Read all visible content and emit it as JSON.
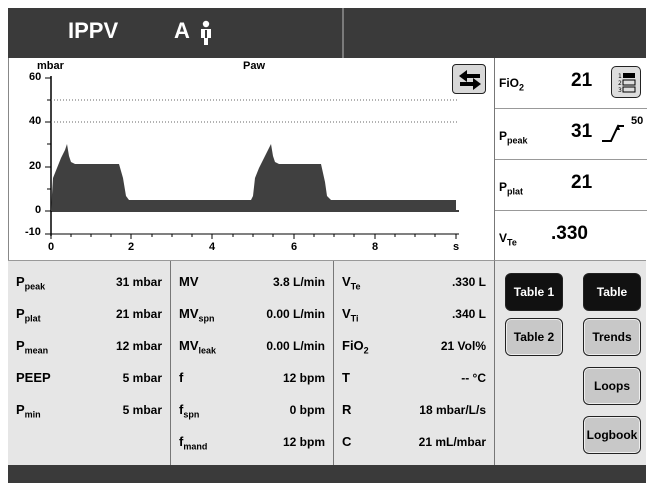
{
  "header": {
    "mode": "IPPV",
    "submode": "A"
  },
  "graph": {
    "y_unit": "mbar",
    "signal": "Paw",
    "y_ticks": [
      "60",
      "40",
      "20",
      "0",
      "-10"
    ],
    "x_ticks": [
      "0",
      "2",
      "4",
      "6",
      "8",
      "s"
    ],
    "swap_icon": "swap-arrows-icon"
  },
  "params": {
    "fio2_label": "FiO",
    "fio2_sub": "2",
    "fio2_value": "21",
    "ppeak_label": "P",
    "ppeak_sub": "peak",
    "ppeak_value": "31",
    "ppeak_limit": "50",
    "pplat_label": "P",
    "pplat_sub": "plat",
    "pplat_value": "21",
    "vte_label": "V",
    "vte_sub": "Te",
    "vte_value": ".330"
  },
  "table": {
    "col1": [
      {
        "lab": "P",
        "sub": "peak",
        "val": "31 mbar"
      },
      {
        "lab": "P",
        "sub": "plat",
        "val": "21 mbar"
      },
      {
        "lab": "P",
        "sub": "mean",
        "val": "12 mbar"
      },
      {
        "lab": "PEEP",
        "sub": "",
        "val": "5 mbar"
      },
      {
        "lab": "P",
        "sub": "min",
        "val": "5 mbar"
      }
    ],
    "col2": [
      {
        "lab": "MV",
        "sub": "",
        "val": "3.8 L/min"
      },
      {
        "lab": "MV",
        "sub": "spn",
        "val": "0.00 L/min"
      },
      {
        "lab": "MV",
        "sub": "leak",
        "val": "0.00 L/min"
      },
      {
        "lab": "f",
        "sub": "",
        "val": "12 bpm"
      },
      {
        "lab": "f",
        "sub": "spn",
        "val": "0 bpm"
      },
      {
        "lab": "f",
        "sub": "mand",
        "val": "12 bpm"
      }
    ],
    "col3": [
      {
        "lab": "V",
        "sub": "Te",
        "val": ".330 L"
      },
      {
        "lab": "V",
        "sub": "Ti",
        "val": ".340 L"
      },
      {
        "lab": "FiO",
        "sub": "2",
        "val": "21 Vol%"
      },
      {
        "lab": "T",
        "sub": "",
        "val": "-- °C"
      },
      {
        "lab": "R",
        "sub": "",
        "val": "18 mbar/L/s"
      },
      {
        "lab": "C",
        "sub": "",
        "val": "21 mL/mbar"
      }
    ]
  },
  "buttons": {
    "table1": "Table 1",
    "table2": "Table 2",
    "table": "Table",
    "trends": "Trends",
    "loops": "Loops",
    "logbook": "Logbook"
  },
  "colors": {
    "header": "#3a3a3a",
    "panel": "#e6e6e6",
    "waveform": "#404040"
  }
}
